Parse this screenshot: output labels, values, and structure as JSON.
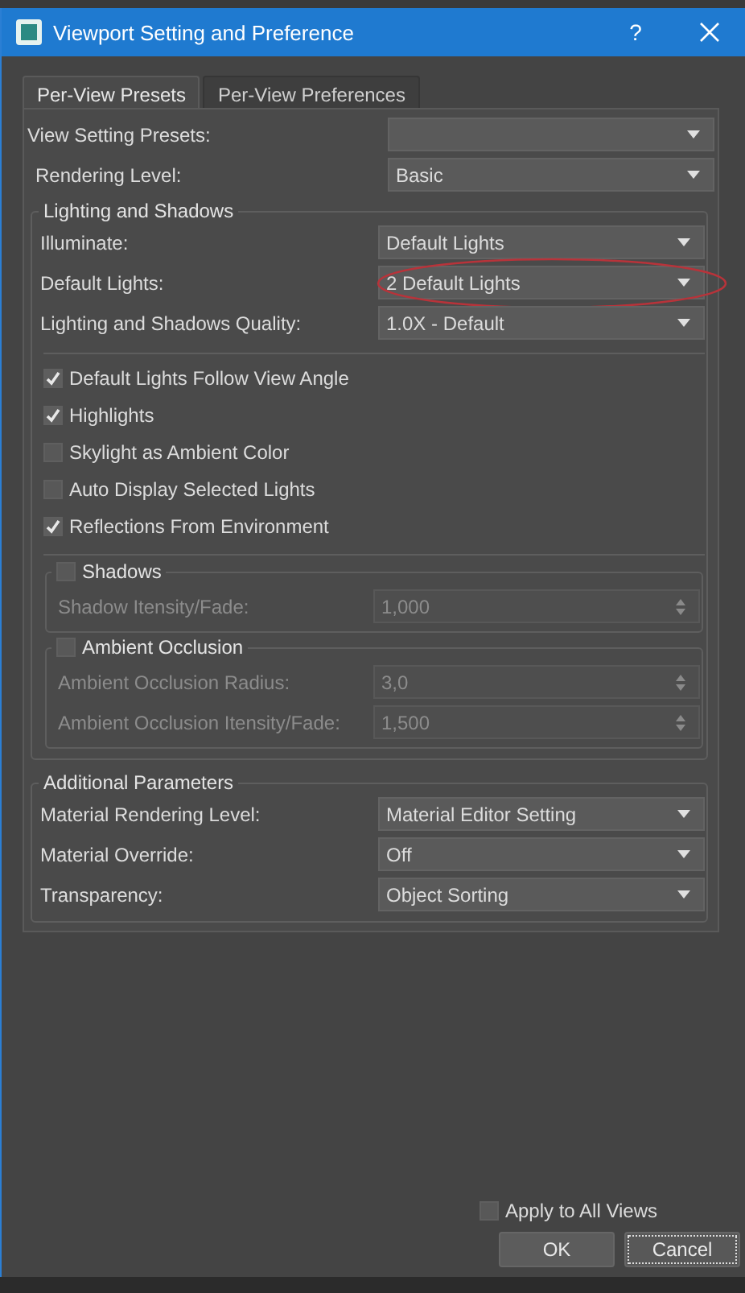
{
  "window": {
    "title": "Viewport Setting and Preference",
    "help": "?"
  },
  "tabs": [
    {
      "label": "Per-View Presets",
      "selected": true
    },
    {
      "label": "Per-View Preferences",
      "selected": false
    }
  ],
  "presets": [
    {
      "label": "View Setting Presets:"
    },
    {
      "label": "Rendering Level:",
      "value": "Basic"
    }
  ],
  "lighting": {
    "title": "Lighting and Shadows",
    "fields": [
      {
        "label": "Illuminate:",
        "value": "Default Lights",
        "highlighted": false
      },
      {
        "label": "Default Lights:",
        "value": "2 Default Lights",
        "highlighted": true
      },
      {
        "label": "Lighting and Shadows Quality:",
        "value": "1.0X - Default",
        "highlighted": false
      }
    ],
    "checkboxes": [
      {
        "label": "Default Lights Follow View Angle",
        "checked": true
      },
      {
        "label": "Highlights",
        "checked": true
      },
      {
        "label": "Skylight as Ambient Color",
        "checked": false
      },
      {
        "label": "Auto Display Selected Lights",
        "checked": false
      },
      {
        "label": "Reflections From Environment",
        "checked": true
      }
    ],
    "subgroups": [
      {
        "title": "Shadows",
        "checked": false,
        "fields": [
          {
            "label": "Shadow Itensity/Fade:",
            "value": "1,000",
            "disabled": true
          }
        ]
      },
      {
        "title": "Ambient Occlusion",
        "checked": false,
        "fields": [
          {
            "label": "Ambient Occlusion Radius:",
            "value": "3,0",
            "disabled": true
          },
          {
            "label": "Ambient Occlusion Itensity/Fade:",
            "value": "1,500",
            "disabled": true
          }
        ]
      }
    ]
  },
  "additional": {
    "title": "Additional Parameters",
    "fields": [
      {
        "label": "Material Rendering Level:",
        "value": "Material Editor Setting"
      },
      {
        "label": "Material Override:",
        "value": "Off"
      },
      {
        "label": "Transparency:",
        "value": "Object Sorting"
      }
    ]
  },
  "apply": {
    "label": "Apply to All Views",
    "checked": false
  },
  "buttons": [
    {
      "label": "OK",
      "focused": false
    },
    {
      "label": "Cancel",
      "focused": true
    }
  ]
}
